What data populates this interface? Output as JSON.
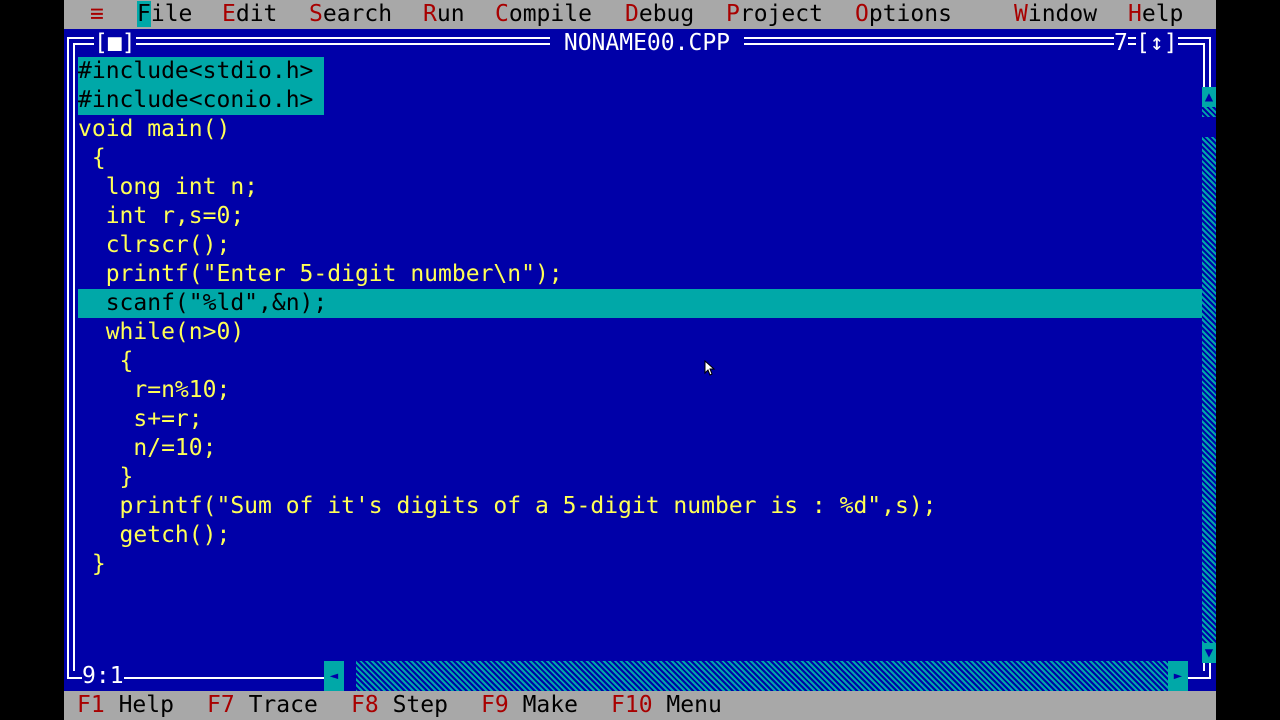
{
  "menu": {
    "system": "≡",
    "items": [
      {
        "hot": "F",
        "rest": "ile"
      },
      {
        "hot": "E",
        "rest": "dit"
      },
      {
        "hot": "S",
        "rest": "earch"
      },
      {
        "hot": "R",
        "rest": "un"
      },
      {
        "hot": "C",
        "rest": "ompile"
      },
      {
        "hot": "D",
        "rest": "ebug"
      },
      {
        "hot": "P",
        "rest": "roject"
      },
      {
        "hot": "O",
        "rest": "ptions"
      },
      {
        "hot": "W",
        "rest": "indow"
      },
      {
        "hot": "H",
        "rest": "elp"
      }
    ]
  },
  "window": {
    "title": " NONAME00.CPP ",
    "close_box": "[■]",
    "number": "7",
    "zoom_box": "[↕]",
    "cursor_position": "9:1"
  },
  "code": {
    "lines": [
      "#include<stdio.h>",
      "#include<conio.h>",
      "void main()",
      " {",
      "  long int n;",
      "  int r,s=0;",
      "  clrscr();",
      "  printf(\"Enter 5-digit number\\n\");",
      "  scanf(\"%ld\",&n);",
      "  while(n>0)",
      "   {",
      "    r=n%10;",
      "    s+=r;",
      "    n/=10;",
      "   }",
      "   printf(\"Sum of it's digits of a 5-digit number is : %d\",s);",
      "   getch();",
      " }"
    ],
    "current_line": 9
  },
  "keys": [
    {
      "key": "F1",
      "label": "Help"
    },
    {
      "key": "F7",
      "label": "Trace"
    },
    {
      "key": "F8",
      "label": "Step"
    },
    {
      "key": "F9",
      "label": "Make"
    },
    {
      "key": "F10",
      "label": "Menu"
    }
  ],
  "colors": {
    "background": "#0000a8",
    "menu_bar": "#a8a8a8",
    "highlight": "#00a8a8",
    "text": "#ffff55",
    "keyword": "#ffffff",
    "string": "#a80000",
    "number": "#a8a8a8"
  }
}
